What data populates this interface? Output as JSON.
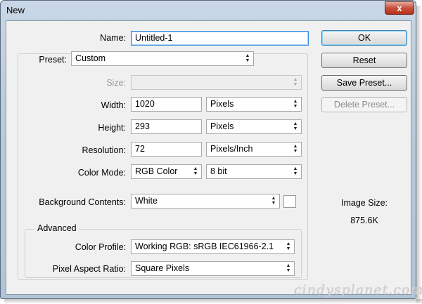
{
  "window": {
    "title": "New",
    "close_symbol": "x"
  },
  "form": {
    "name_label": "Name:",
    "name_value": "Untitled-1",
    "preset_label": "Preset:",
    "preset_value": "Custom",
    "size_label": "Size:",
    "size_value": "",
    "width_label": "Width:",
    "width_value": "1020",
    "width_unit": "Pixels",
    "height_label": "Height:",
    "height_value": "293",
    "height_unit": "Pixels",
    "resolution_label": "Resolution:",
    "resolution_value": "72",
    "resolution_unit": "Pixels/Inch",
    "color_mode_label": "Color Mode:",
    "color_mode_value": "RGB Color",
    "bit_depth_value": "8 bit",
    "background_label": "Background Contents:",
    "background_value": "White",
    "background_swatch_color": "#ffffff"
  },
  "advanced": {
    "title": "Advanced",
    "color_profile_label": "Color Profile:",
    "color_profile_value": "Working RGB:  sRGB IEC61966-2.1",
    "pixel_aspect_label": "Pixel Aspect Ratio:",
    "pixel_aspect_value": "Square Pixels"
  },
  "buttons": {
    "ok": "OK",
    "reset": "Reset",
    "save_preset": "Save Preset...",
    "delete_preset": "Delete Preset..."
  },
  "image_size": {
    "label": "Image Size:",
    "value": "875.6K"
  },
  "watermark": "cindysplanet.com"
}
